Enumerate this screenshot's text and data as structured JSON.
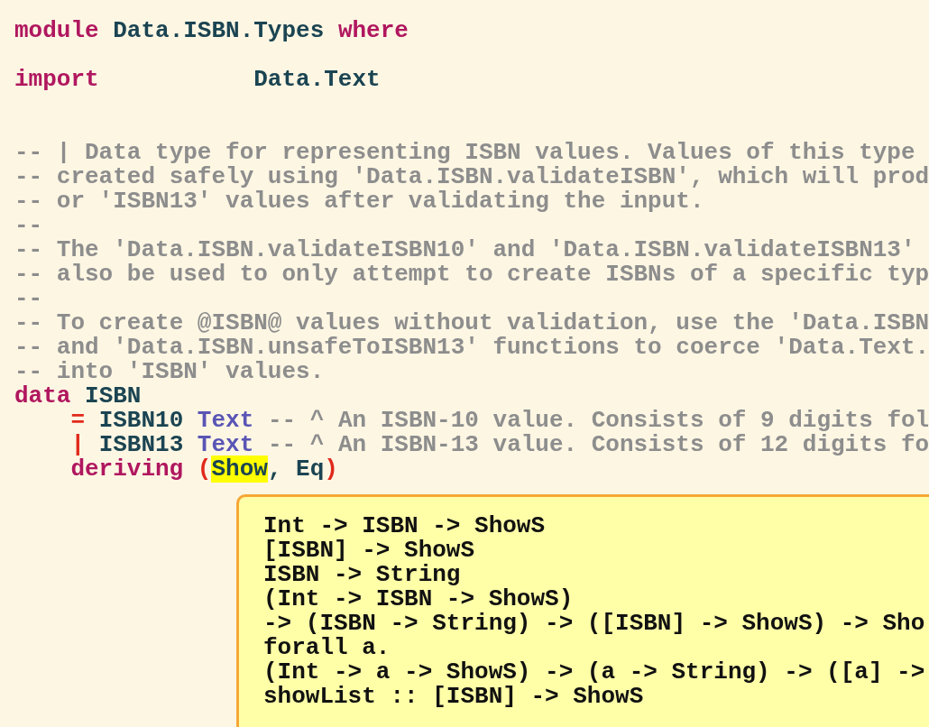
{
  "editor": {
    "lines": [
      {
        "kind": "code",
        "tokens": [
          {
            "kind": "keyword",
            "text": "module"
          },
          {
            "kind": "name",
            "text": "Data.ISBN.Types"
          },
          {
            "kind": "keyword",
            "text": "where"
          }
        ]
      },
      {
        "kind": "blank"
      },
      {
        "kind": "import",
        "tokens": [
          {
            "kind": "keyword",
            "text": "import"
          },
          {
            "kind": "name",
            "text": "Data.Text"
          }
        ]
      },
      {
        "kind": "blank"
      },
      {
        "kind": "blank"
      },
      {
        "kind": "code",
        "tokens": [
          {
            "kind": "comment",
            "text": "-- | Data type for representing ISBN values. Values of this type"
          }
        ]
      },
      {
        "kind": "code",
        "tokens": [
          {
            "kind": "comment",
            "text": "-- created safely using 'Data.ISBN.validateISBN', which will prod"
          }
        ]
      },
      {
        "kind": "code",
        "tokens": [
          {
            "kind": "comment",
            "text": "-- or 'ISBN13' values after validating the input."
          }
        ]
      },
      {
        "kind": "code",
        "tokens": [
          {
            "kind": "comment",
            "text": "--"
          }
        ]
      },
      {
        "kind": "code",
        "tokens": [
          {
            "kind": "comment",
            "text": "-- The 'Data.ISBN.validateISBN10' and 'Data.ISBN.validateISBN13'"
          }
        ]
      },
      {
        "kind": "code",
        "tokens": [
          {
            "kind": "comment",
            "text": "-- also be used to only attempt to create ISBNs of a specific typ"
          }
        ]
      },
      {
        "kind": "code",
        "tokens": [
          {
            "kind": "comment",
            "text": "--"
          }
        ]
      },
      {
        "kind": "code",
        "tokens": [
          {
            "kind": "comment",
            "text": "-- To create @ISBN@ values without validation, use the 'Data.ISBN"
          }
        ]
      },
      {
        "kind": "code",
        "tokens": [
          {
            "kind": "comment",
            "text": "-- and 'Data.ISBN.unsafeToISBN13' functions to coerce 'Data.Text."
          }
        ]
      },
      {
        "kind": "code",
        "tokens": [
          {
            "kind": "comment",
            "text": "-- into 'ISBN' values."
          }
        ]
      },
      {
        "kind": "code",
        "tokens": [
          {
            "kind": "keyword",
            "text": "data"
          },
          {
            "kind": "name",
            "text": "ISBN"
          }
        ]
      },
      {
        "kind": "code",
        "indented": true,
        "tokens": [
          {
            "kind": "operator",
            "text": "="
          },
          {
            "kind": "name",
            "text": "ISBN10"
          },
          {
            "kind": "type",
            "text": "Text"
          },
          {
            "kind": "comment",
            "text": "-- ^ An ISBN-10 value. Consists of 9 digits fol"
          }
        ]
      },
      {
        "kind": "code",
        "indented": true,
        "tokens": [
          {
            "kind": "operator",
            "text": "|"
          },
          {
            "kind": "name",
            "text": "ISBN13"
          },
          {
            "kind": "type",
            "text": "Text"
          },
          {
            "kind": "comment",
            "text": "-- ^ An ISBN-13 value. Consists of 12 digits fo"
          }
        ]
      },
      {
        "kind": "code",
        "indented": true,
        "tokens": [
          {
            "kind": "keyword",
            "text": "deriving"
          },
          {
            "kind": "operator",
            "text": "("
          },
          {
            "kind": "highlight",
            "text": "Show",
            "attached": true
          },
          {
            "kind": "name",
            "text": ",",
            "attached": true
          },
          {
            "kind": "name",
            "text": "Eq"
          },
          {
            "kind": "operator",
            "text": ")",
            "attached": true
          }
        ]
      }
    ]
  },
  "tooltip": {
    "lines": [
      "Int -> ISBN -> ShowS",
      "[ISBN] -> ShowS",
      "ISBN -> String",
      "(Int -> ISBN -> ShowS)",
      "-> (ISBN -> String) -> ([ISBN] -> ShowS) -> Sho",
      "forall a.",
      "(Int -> a -> ShowS) -> (a -> String) -> ([a] ->",
      "showList :: [ISBN] -> ShowS"
    ]
  }
}
